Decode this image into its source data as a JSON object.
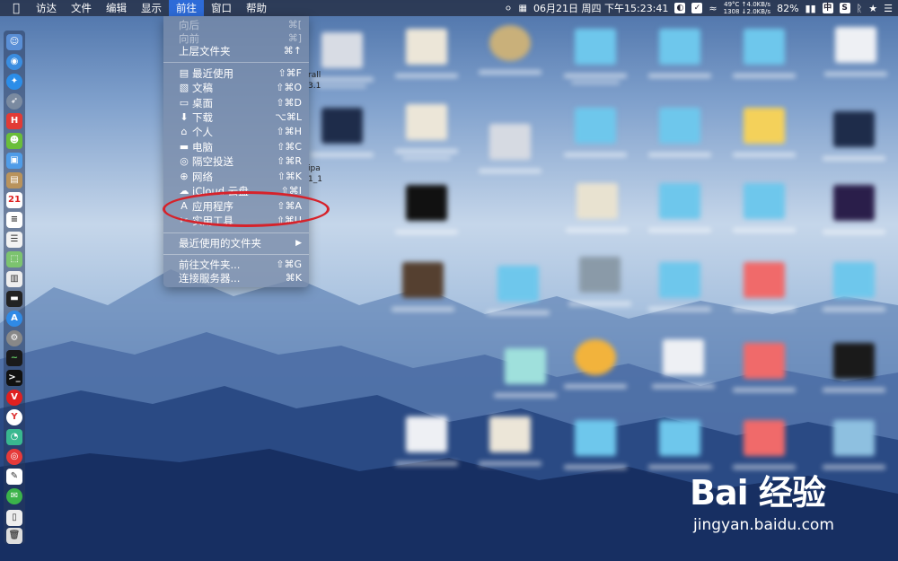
{
  "menubar": {
    "apple": "",
    "items": [
      {
        "label": "访达"
      },
      {
        "label": "文件"
      },
      {
        "label": "编辑"
      },
      {
        "label": "显示"
      },
      {
        "label": "前往"
      },
      {
        "label": "窗口"
      },
      {
        "label": "帮助"
      }
    ],
    "active_index": 4,
    "status": {
      "temp": "49°C",
      "up": "↑4.0KB/s",
      "rpm": "1308",
      "down": "↓2.0KB/s",
      "datetime": "06月21日 周四 下午15:23:41",
      "battery": "82%",
      "input_method": "中"
    }
  },
  "go_menu": {
    "items": [
      {
        "label": "向后",
        "shortcut": "⌘[",
        "icon": "",
        "disabled": true
      },
      {
        "label": "向前",
        "shortcut": "⌘]",
        "icon": "",
        "disabled": true
      },
      {
        "label": "上层文件夹",
        "shortcut": "⌘↑",
        "icon": ""
      },
      {
        "label": "最近使用",
        "shortcut": "⇧⌘F",
        "icon": "recents-icon"
      },
      {
        "label": "文稿",
        "shortcut": "⇧⌘O",
        "icon": "documents-icon"
      },
      {
        "label": "桌面",
        "shortcut": "⇧⌘D",
        "icon": "desktop-icon"
      },
      {
        "label": "下载",
        "shortcut": "⌥⌘L",
        "icon": "downloads-icon"
      },
      {
        "label": "个人",
        "shortcut": "⇧⌘H",
        "icon": "home-icon"
      },
      {
        "label": "电脑",
        "shortcut": "⇧⌘C",
        "icon": "computer-icon"
      },
      {
        "label": "隔空投送",
        "shortcut": "⇧⌘R",
        "icon": "airdrop-icon"
      },
      {
        "label": "网络",
        "shortcut": "⇧⌘K",
        "icon": "network-icon"
      },
      {
        "label": "iCloud 云盘",
        "shortcut": "⇧⌘I",
        "icon": "icloud-icon"
      },
      {
        "label": "应用程序",
        "shortcut": "⇧⌘A",
        "icon": "applications-icon",
        "highlighted": true
      },
      {
        "label": "实用工具",
        "shortcut": "⇧⌘U",
        "icon": "utilities-icon"
      },
      {
        "label": "最近使用的文件夹",
        "shortcut": "▶",
        "icon": ""
      },
      {
        "label": "前往文件夹...",
        "shortcut": "⇧⌘G",
        "icon": ""
      },
      {
        "label": "连接服务器...",
        "shortcut": "⌘K",
        "icon": ""
      }
    ]
  },
  "background_window": {
    "partial_text_1": "rall",
    "partial_text_2": "3.1",
    "partial_text_3": "ipa",
    "partial_text_4": "1_1"
  },
  "watermark": {
    "brand": "Bai 经验",
    "url": "jingyan.baidu.com"
  },
  "colors": {
    "menubar_active": "#2d6bd8",
    "highlight_circle": "#d6222a"
  }
}
